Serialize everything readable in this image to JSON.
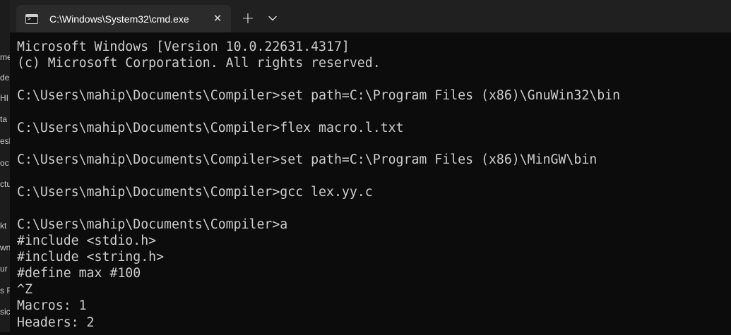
{
  "background_window": {
    "fragments": [
      "me",
      "de",
      "HI",
      "ta",
      "esl",
      "oc",
      "ctu",
      "kt",
      "wn",
      "ur",
      "s P",
      "sic"
    ]
  },
  "window": {
    "tab": {
      "title": "C:\\Windows\\System32\\cmd.exe",
      "icon": "cmd-prompt-icon",
      "close_glyph": "✕"
    },
    "new_tab_glyph": "+",
    "dropdown_icon": "chevron-down-icon"
  },
  "console": {
    "lines": [
      "Microsoft Windows [Version 10.0.22631.4317]",
      "(c) Microsoft Corporation. All rights reserved.",
      "",
      "C:\\Users\\mahip\\Documents\\Compiler>set path=C:\\Program Files (x86)\\GnuWin32\\bin",
      "",
      "C:\\Users\\mahip\\Documents\\Compiler>flex macro.l.txt",
      "",
      "C:\\Users\\mahip\\Documents\\Compiler>set path=C:\\Program Files (x86)\\MinGW\\bin",
      "",
      "C:\\Users\\mahip\\Documents\\Compiler>gcc lex.yy.c",
      "",
      "C:\\Users\\mahip\\Documents\\Compiler>a",
      "#include <stdio.h>",
      "#include <string.h>",
      "#define max #100",
      "^Z",
      "Macros: 1",
      "Headers: 2"
    ]
  },
  "colors": {
    "console_bg": "#0c0c0c",
    "console_text": "#cccccc",
    "titlebar_bg": "#202020",
    "tab_bg": "#2b2b2b"
  }
}
